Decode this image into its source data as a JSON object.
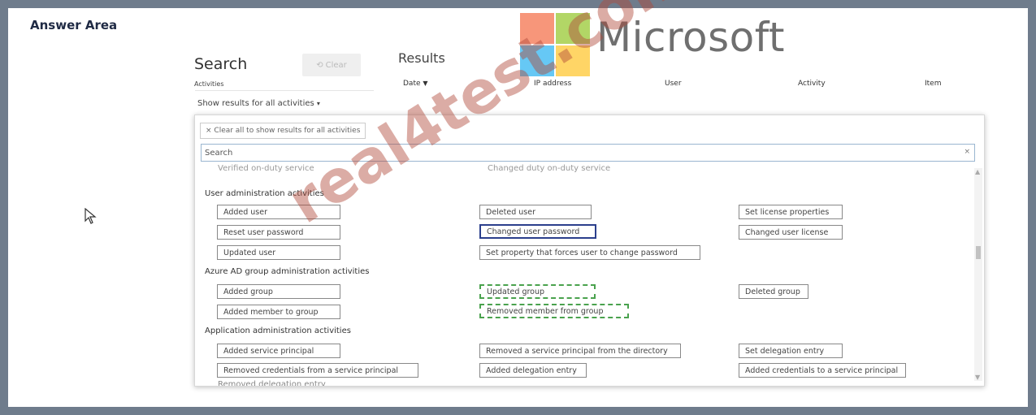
{
  "answer_area": {
    "title": "Answer Area"
  },
  "search": {
    "title": "Search",
    "clear_label": "Clear",
    "activities_label": "Activities",
    "show_results": "Show results for all activities"
  },
  "results": {
    "title": "Results",
    "columns": [
      "Date",
      "IP address",
      "User",
      "Activity",
      "Item"
    ]
  },
  "panel": {
    "clear_all": "Clear all to show results for all activities",
    "search_placeholder": "Search",
    "cut_top_left": "Verified on-duty service",
    "cut_top_mid": "Changed duty on-duty service",
    "groups": [
      {
        "heading": "User administration activities",
        "items": [
          "Added user",
          "Deleted user",
          "Set license properties",
          "Reset user password",
          "Changed user password",
          "Changed user license",
          "Updated user",
          "Set property that forces user to change password"
        ]
      },
      {
        "heading": "Azure AD group administration activities",
        "items": [
          "Added group",
          "Updated group",
          "Deleted group",
          "Added member to group",
          "Removed member from group"
        ]
      },
      {
        "heading": "Application administration activities",
        "items": [
          "Added service principal",
          "Removed a service principal from the directory",
          "Set delegation entry",
          "Removed credentials from a service principal",
          "Added delegation entry",
          "Added credentials to a service principal"
        ]
      }
    ],
    "cut_bottom": "Removed delegation entry"
  },
  "branding": {
    "name": "Microsoft",
    "watermark": "real4test.com",
    "colors": {
      "red": "#f25022",
      "green": "#7fba00",
      "blue": "#00a4ef",
      "yellow": "#ffb900"
    }
  },
  "states": {
    "selected_border": "#2b3f8c",
    "dashed_border": "#4aa24e"
  }
}
